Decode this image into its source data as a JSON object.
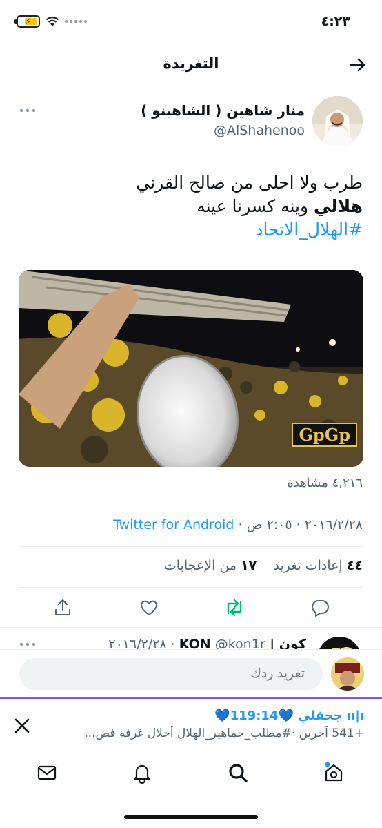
{
  "status_bar": {
    "time": "٤:٢٣"
  },
  "header": {
    "title": "التغريدة"
  },
  "tweet": {
    "author_name": "منار شاهين ( الشاهينو )",
    "author_handle": "@AlShahenoo",
    "text_line1": "طرب ولا احلى من صالح القرني",
    "text_line2_bold": "هلالي",
    "text_line2_rest": " وينه كسرنا عينه",
    "hashtag": "#الهلال_الاتحاد",
    "media_watermark": "GpGp",
    "views": "٤,٢١٦ مشاهدة",
    "date": "٢٠١٦/٢/٢٨",
    "time": "٢:٠٥ ص",
    "source": "Twitter for Android",
    "retweets_count": "٤٤",
    "retweets_label": "إعادات تغريد",
    "likes_count": "١٧",
    "likes_label": "من الإعجابات"
  },
  "reply_preview": {
    "name": "كون | KON",
    "handle_date": "@kon1r · ٢٠١٦/٢/٢٨"
  },
  "reply_bar": {
    "placeholder": "تغريد ردك"
  },
  "spaces": {
    "title": "جحفلي",
    "duration": "119:14",
    "subtitle": "+541 آخرين  ·#مطلب_جماهير_الهلال أحلال غرفة فض..."
  },
  "icons": {
    "back": "arrow-right-icon",
    "more": "more-icon",
    "reply": "comment-icon",
    "retweet": "retweet-icon",
    "like": "heart-icon",
    "share": "share-icon",
    "close": "close-icon",
    "nav_home": "home-icon",
    "nav_search": "search-icon",
    "nav_notifications": "bell-icon",
    "nav_messages": "mail-icon"
  },
  "colors": {
    "accent": "#1d9bf0",
    "retweet": "#00ba7c",
    "spaces": "#7856ff"
  }
}
